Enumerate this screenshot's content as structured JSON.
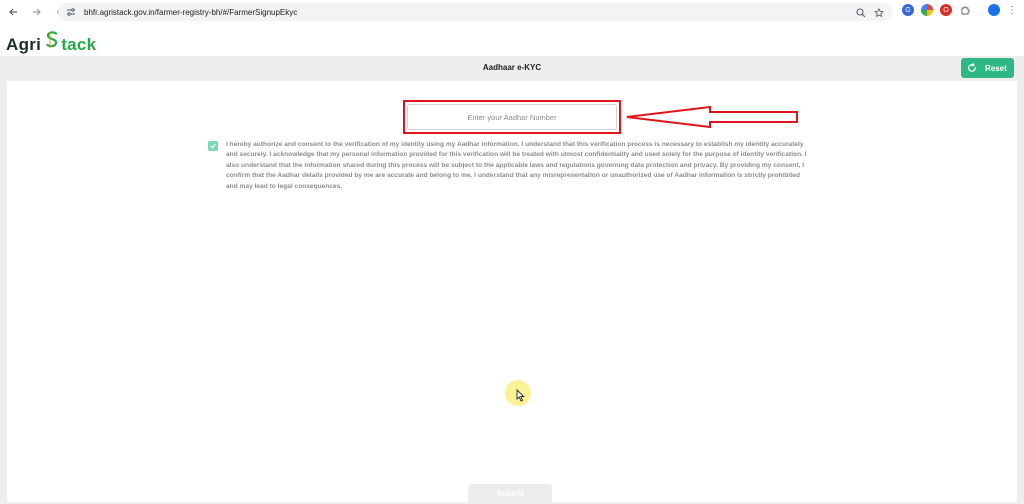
{
  "browser": {
    "url": "bhfr.agristack.gov.in/farmer-registry-bh/#/FarmerSignupEkyc",
    "extension_labels": [
      "G",
      "",
      "O"
    ]
  },
  "logo": {
    "part1": "Agri",
    "part2": "tack"
  },
  "page": {
    "title": "Aadhaar e-KYC",
    "reset_label": "Reset",
    "aadhar_placeholder": "Enter your Aadhar Number",
    "consent_checked": true,
    "consent_text": "I hereby authorize and consent to the verification of my identity using my Aadhar information. I understand that this verification process is necessary to establish my identity accurately and securely. I acknowledge that my personal information provided for this verification will be treated with utmost confidentiality and used solely for the purpose of identity verification. I also understand that the information shared during this process will be subject to the applicable laws and regulations governing data protection and privacy. By providing my consent, I confirm that the Aadhar details provided by me are accurate and belong to me. I understand that any misrepresentation or unauthorized use of Aadhar information is strictly prohibited and may lead to legal consequences.",
    "submit_label": "Submit"
  },
  "colors": {
    "accent": "#2fb785",
    "annotation": "#e0141c",
    "checkbox": "#7ed6b2"
  },
  "icons": {
    "back": "arrow-left-icon",
    "forward": "arrow-right-icon",
    "reload": "reload-icon",
    "reset": "refresh-icon"
  }
}
